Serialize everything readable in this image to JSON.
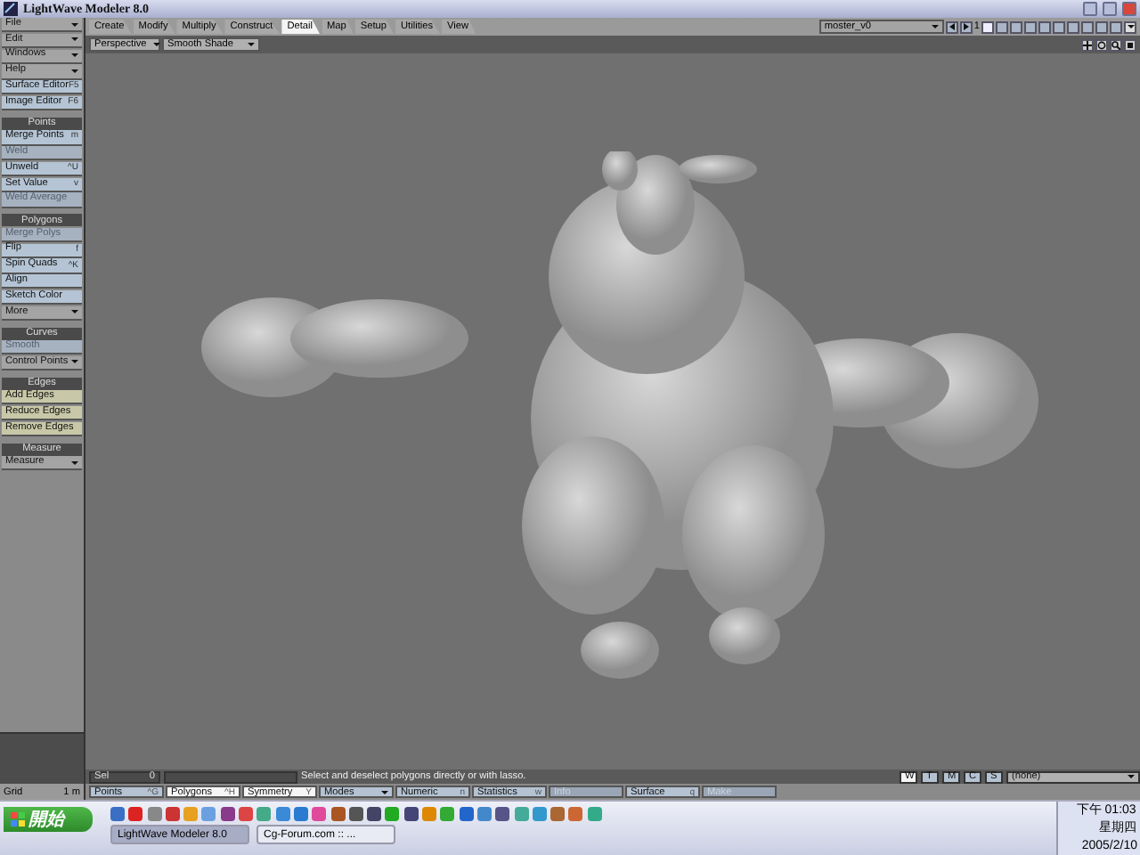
{
  "window": {
    "title": "LightWave Modeler 8.0"
  },
  "menus": [
    {
      "label": "File",
      "kind": "dropdown"
    },
    {
      "label": "Edit",
      "kind": "dropdown"
    },
    {
      "label": "Windows",
      "kind": "dropdown"
    },
    {
      "label": "Help",
      "kind": "dropdown"
    },
    {
      "label": "Surface Editor",
      "kind": "command",
      "shortcut": "F5"
    },
    {
      "label": "Image Editor",
      "kind": "command",
      "shortcut": "F6"
    }
  ],
  "tool_groups": [
    {
      "title": "Points",
      "items": [
        {
          "label": "Merge Points",
          "kind": "command",
          "shortcut": "m",
          "disabled": false
        },
        {
          "label": "Weld",
          "kind": "command",
          "disabled": true
        },
        {
          "label": "Unweld",
          "kind": "command",
          "shortcut": "^U",
          "disabled": false
        },
        {
          "label": "Set Value",
          "kind": "command",
          "shortcut": "v",
          "disabled": false
        },
        {
          "label": "Weld Average",
          "kind": "command",
          "disabled": true
        }
      ]
    },
    {
      "title": "Polygons",
      "items": [
        {
          "label": "Merge Polys",
          "kind": "command",
          "disabled": true
        },
        {
          "label": "Flip",
          "kind": "command",
          "shortcut": "f",
          "disabled": false
        },
        {
          "label": "Spin Quads",
          "kind": "command",
          "shortcut": "^K",
          "disabled": false
        },
        {
          "label": "Align",
          "kind": "command",
          "disabled": false
        },
        {
          "label": "Sketch Color",
          "kind": "command",
          "disabled": false
        },
        {
          "label": "More",
          "kind": "dropdown",
          "disabled": false
        }
      ]
    },
    {
      "title": "Curves",
      "items": [
        {
          "label": "Smooth",
          "kind": "command",
          "disabled": true
        },
        {
          "label": "Control Points",
          "kind": "dropdown",
          "disabled": false
        }
      ]
    },
    {
      "title": "Edges",
      "items": [
        {
          "label": "Add Edges",
          "kind": "command",
          "disabled": false
        },
        {
          "label": "Reduce Edges",
          "kind": "command",
          "disabled": false
        },
        {
          "label": "Remove Edges",
          "kind": "command",
          "disabled": false
        }
      ]
    },
    {
      "title": "Measure",
      "items": [
        {
          "label": "Measure",
          "kind": "dropdown",
          "disabled": false
        }
      ]
    }
  ],
  "tabs": [
    {
      "label": "Create",
      "selected": false
    },
    {
      "label": "Modify",
      "selected": false
    },
    {
      "label": "Multiply",
      "selected": false
    },
    {
      "label": "Construct",
      "selected": false
    },
    {
      "label": "Detail",
      "selected": true
    },
    {
      "label": "Map",
      "selected": false
    },
    {
      "label": "Setup",
      "selected": false
    },
    {
      "label": "Utilities",
      "selected": false
    },
    {
      "label": "View",
      "selected": false
    }
  ],
  "object_menu": {
    "value": "moster_v0"
  },
  "layer_bar": {
    "number": "1"
  },
  "viewport": {
    "view": "Perspective",
    "shading": "Smooth Shade"
  },
  "status": {
    "sel_label": "Sel",
    "sel_value": "0",
    "message": "Select and deselect polygons directly or with lasso.",
    "layer_modes": [
      {
        "label": "W",
        "selected": true
      },
      {
        "label": "T",
        "selected": false
      },
      {
        "label": "M",
        "selected": false
      },
      {
        "label": "C",
        "selected": false
      },
      {
        "label": "S",
        "selected": false
      }
    ],
    "surface_menu": "(none)"
  },
  "grid": {
    "label": "Grid",
    "value": "1 m"
  },
  "bottom_buttons": [
    {
      "label": "Points",
      "shortcut": "^G",
      "on": false,
      "disabled": false,
      "kind": "toggle"
    },
    {
      "label": "Polygons",
      "shortcut": "^H",
      "on": true,
      "disabled": false,
      "kind": "toggle"
    },
    {
      "label": "Symmetry",
      "shortcut": "Y",
      "on": true,
      "disabled": false,
      "kind": "toggle"
    },
    {
      "label": "Modes",
      "on": false,
      "disabled": false,
      "kind": "dropdown"
    },
    {
      "label": "Numeric",
      "shortcut": "n",
      "on": false,
      "disabled": false,
      "kind": "toggle"
    },
    {
      "label": "Statistics",
      "shortcut": "w",
      "on": false,
      "disabled": false,
      "kind": "toggle"
    },
    {
      "label": "Info",
      "on": false,
      "disabled": true,
      "kind": "toggle"
    },
    {
      "label": "Surface",
      "shortcut": "q",
      "on": false,
      "disabled": false,
      "kind": "toggle"
    },
    {
      "label": "Make",
      "on": false,
      "disabled": true,
      "kind": "toggle"
    }
  ],
  "taskbar": {
    "start": "開始",
    "tasks": [
      {
        "label": "LightWave Modeler 8.0",
        "selected": true
      },
      {
        "label": "Cg-Forum.com :: ...",
        "selected": false
      }
    ],
    "clock": {
      "time": "下午 01:03",
      "weekday": "星期四",
      "date": "2005/2/10"
    }
  }
}
